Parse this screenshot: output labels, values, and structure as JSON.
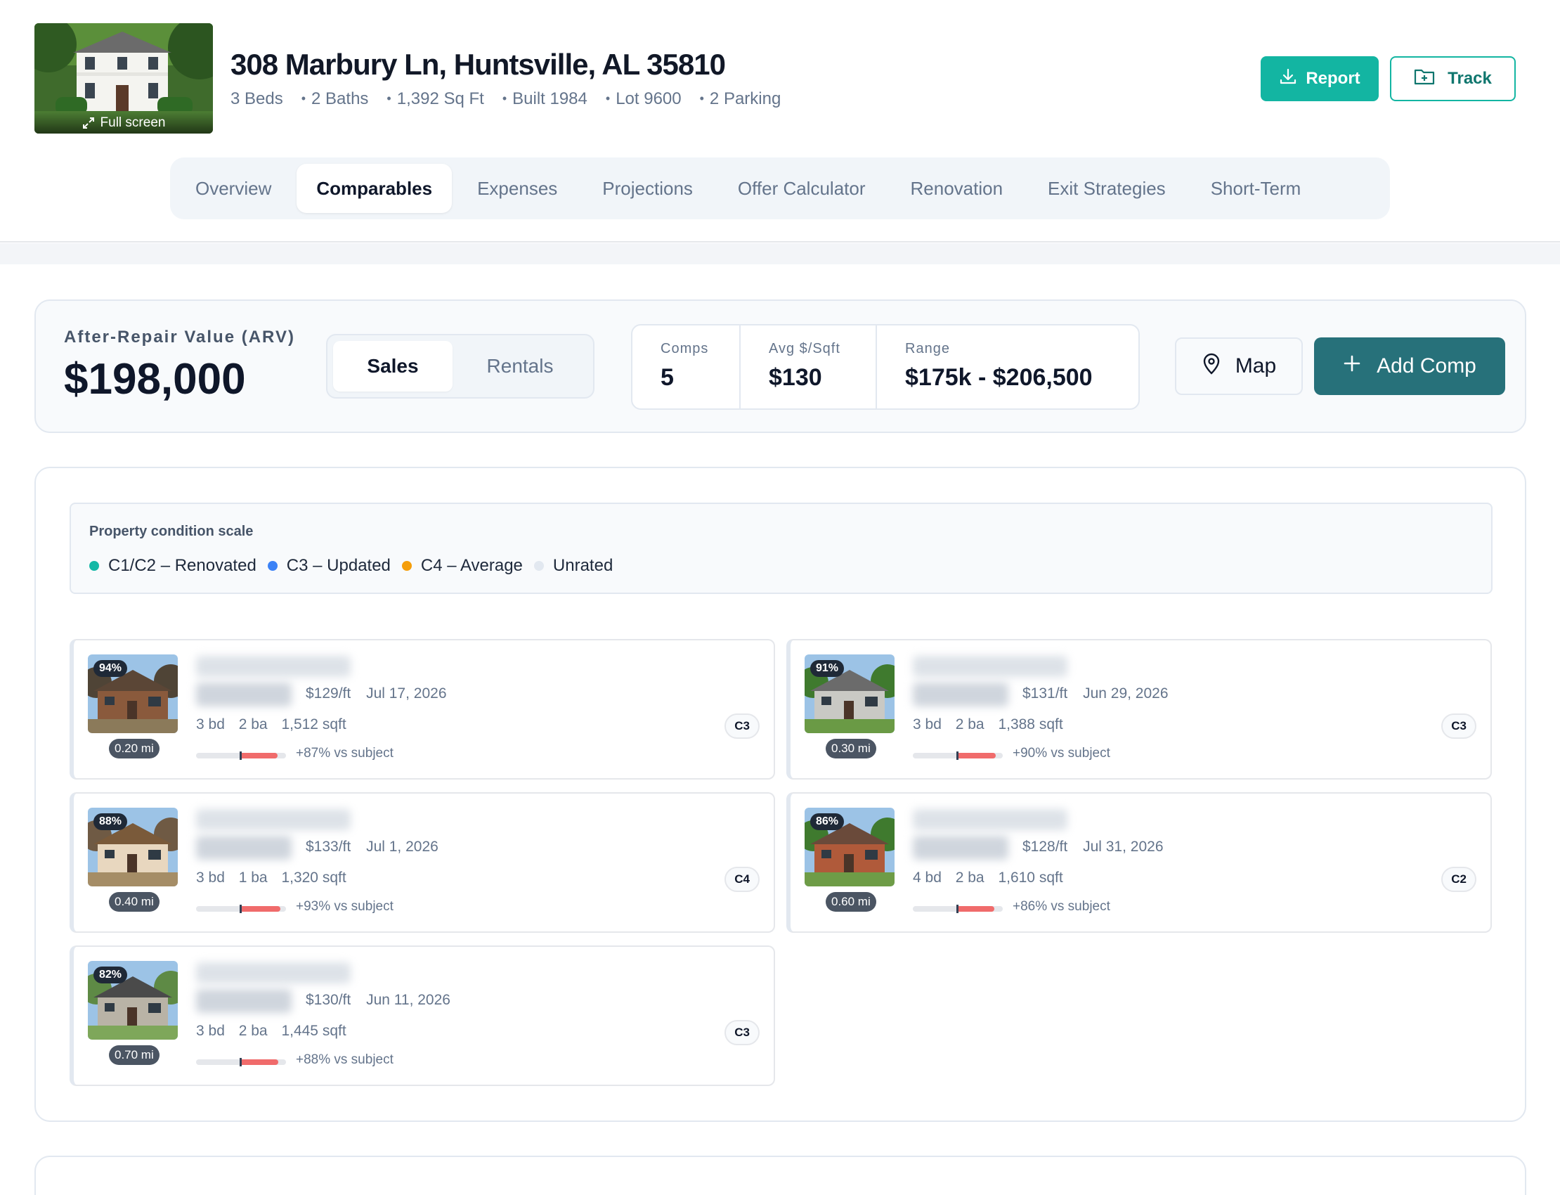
{
  "property": {
    "address": "308 Marbury Ln, Huntsville, AL 35810",
    "fullscreen_label": "Full screen",
    "facts": [
      "3 Beds",
      "2 Baths",
      "1,392 Sq Ft",
      "Built 1984",
      "Lot 9600",
      "2 Parking"
    ]
  },
  "actions": {
    "report": "Report",
    "track": "Track"
  },
  "tabs": [
    "Overview",
    "Comparables",
    "Expenses",
    "Projections",
    "Offer Calculator",
    "Renovation",
    "Exit Strategies",
    "Short-Term"
  ],
  "active_tab": "Comparables",
  "arv": {
    "label": "After-Repair Value (ARV)",
    "value": "$198,000",
    "modes": [
      "Sales",
      "Rentals"
    ],
    "active_mode": "Sales",
    "stats": [
      {
        "label": "Comps",
        "value": "5"
      },
      {
        "label": "Avg $/Sqft",
        "value": "$130"
      },
      {
        "label": "Range",
        "value": "$175k - $206,500"
      }
    ],
    "map_label": "Map",
    "add_label": "Add Comp"
  },
  "condition_scale": {
    "title": "Property condition scale",
    "items": [
      {
        "label": "C1/C2 – Renovated",
        "color": "#14b8a6"
      },
      {
        "label": "C3 – Updated",
        "color": "#3b82f6"
      },
      {
        "label": "C4 – Average",
        "color": "#f59e0b"
      },
      {
        "label": "Unrated",
        "color": "#e2e8f0"
      }
    ]
  },
  "comps": [
    {
      "match": "94%",
      "distance": "0.20 mi",
      "ppsf": "$129/ft",
      "date": "Jul 17, 2026",
      "beds": "3 bd",
      "baths": "2 ba",
      "sqft": "1,512 sqft",
      "vs": "+87% vs subject",
      "vs_value": 87,
      "condition": "C3",
      "photo": "brick-ranch"
    },
    {
      "match": "91%",
      "distance": "0.30 mi",
      "ppsf": "$131/ft",
      "date": "Jun 29, 2026",
      "beds": "3 bd",
      "baths": "2 ba",
      "sqft": "1,388 sqft",
      "vs": "+90% vs subject",
      "vs_value": 90,
      "condition": "C3",
      "photo": "gray-ranch"
    },
    {
      "match": "88%",
      "distance": "0.40 mi",
      "ppsf": "$133/ft",
      "date": "Jul 1, 2026",
      "beds": "3 bd",
      "baths": "1 ba",
      "sqft": "1,320 sqft",
      "vs": "+93% vs subject",
      "vs_value": 93,
      "condition": "C4",
      "photo": "tan-cottage"
    },
    {
      "match": "86%",
      "distance": "0.60 mi",
      "ppsf": "$128/ft",
      "date": "Jul 31, 2026",
      "beds": "4 bd",
      "baths": "2 ba",
      "sqft": "1,610 sqft",
      "vs": "+86% vs subject",
      "vs_value": 86,
      "condition": "C2",
      "photo": "brick-two-story"
    },
    {
      "match": "82%",
      "distance": "0.70 mi",
      "ppsf": "$130/ft",
      "date": "Jun 11, 2026",
      "beds": "3 bd",
      "baths": "2 ba",
      "sqft": "1,445 sqft",
      "vs": "+88% vs subject",
      "vs_value": 88,
      "condition": "C3",
      "photo": "craftsman"
    }
  ]
}
